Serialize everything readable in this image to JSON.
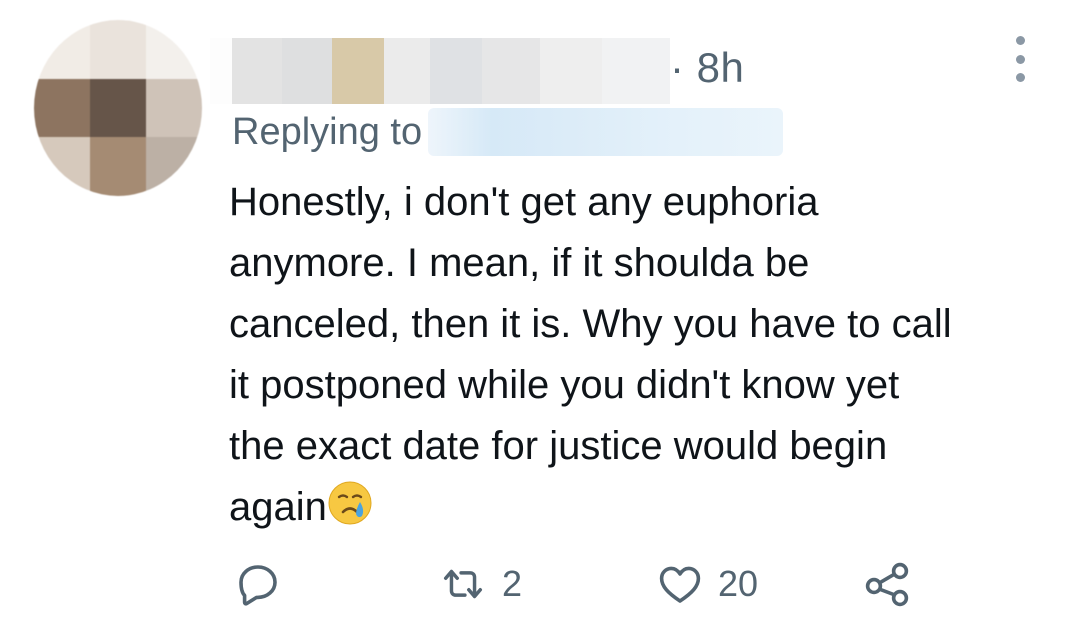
{
  "tweet": {
    "timestamp": "· 8h",
    "replying_to_label": "Replying to",
    "text": "Honestly, i don't get any euphoria\nanymore. I mean, if it shoulda be\ncanceled, then it is. Why you have to call\nit postponed while you didn't know yet\nthe exact date for justice would begin\nagain",
    "emoji_icon": "crying-face-emoji"
  },
  "actions": {
    "reply_icon": "reply-icon",
    "retweet_icon": "retweet-icon",
    "retweet_count": "2",
    "like_icon": "heart-icon",
    "like_count": "20",
    "share_icon": "share-icon"
  },
  "colors": {
    "text": "#0f1419",
    "secondary": "#536471",
    "dots": "#8b98a5"
  }
}
